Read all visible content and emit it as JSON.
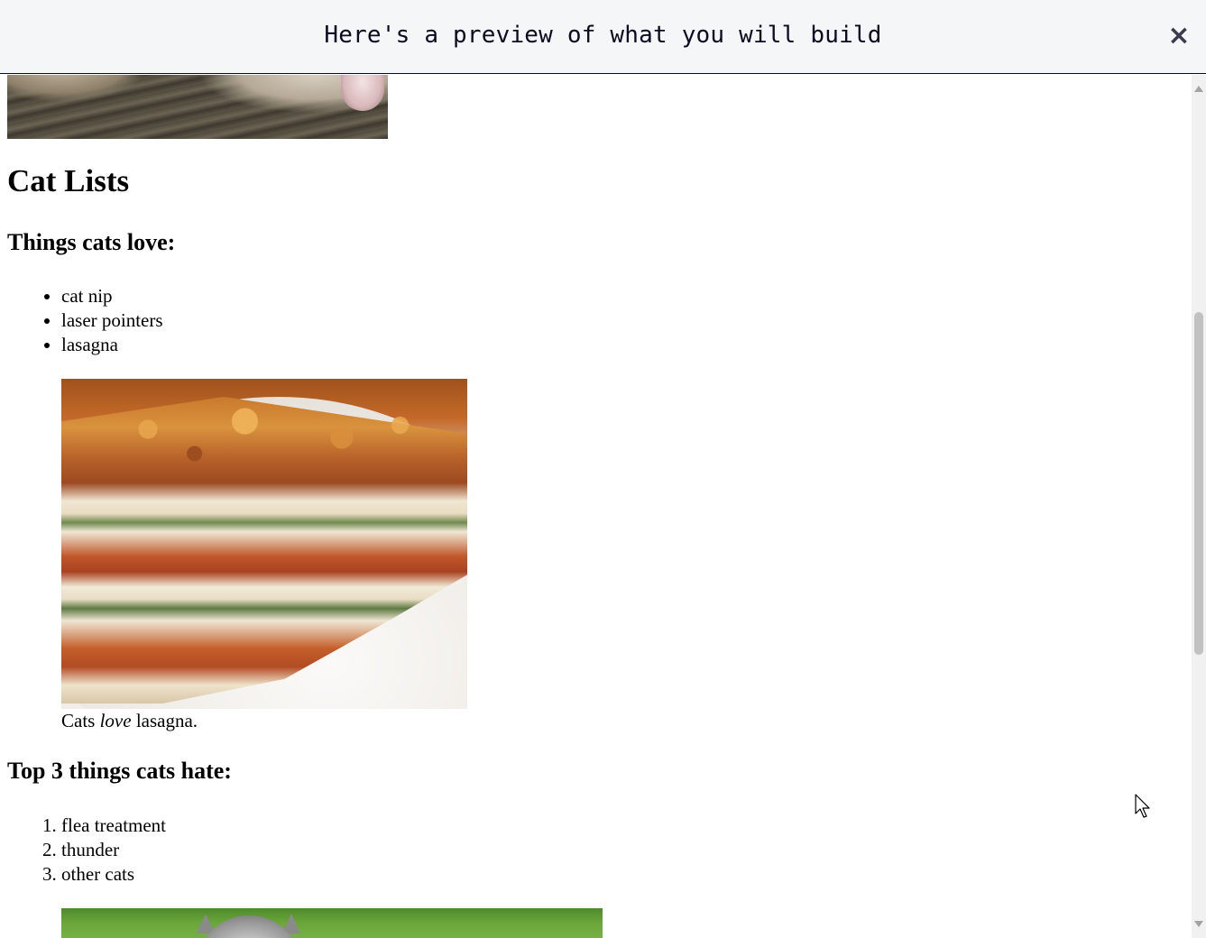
{
  "banner": {
    "title": "Here's a preview of what you will build",
    "close_label": "×"
  },
  "page": {
    "section_title": "Cat Lists",
    "love": {
      "heading": "Things cats love:",
      "items": [
        "cat nip",
        "laser pointers",
        "lasagna"
      ]
    },
    "lasagna_figure": {
      "caption_prefix": "Cats ",
      "caption_emphasis": "love",
      "caption_suffix": " lasagna."
    },
    "hate": {
      "heading": "Top 3 things cats hate:",
      "items": [
        "flea treatment",
        "thunder",
        "other cats"
      ]
    }
  },
  "icons": {
    "close": "close-icon",
    "cursor": "mouse-pointer-icon"
  }
}
